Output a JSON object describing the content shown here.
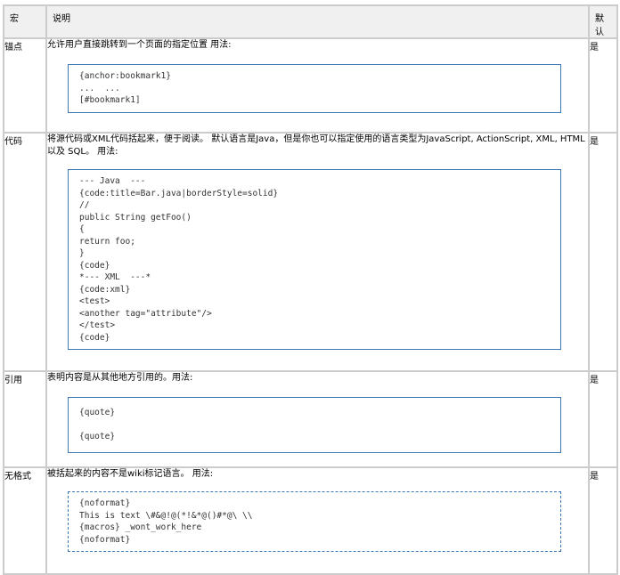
{
  "headers": {
    "macro": "宏",
    "description": "说明",
    "default": "默认"
  },
  "rows": [
    {
      "macro": "锚点",
      "description": "允许用户直接跳转到一个页面的指定位置 用法:",
      "code": [
        "{anchor:bookmark1}",
        "...  ...",
        "[#bookmark1]"
      ],
      "default": "是"
    },
    {
      "macro": "代码",
      "description": "将源代码或XML代码括起来，便于阅读。 默认语言是Java，但是你也可以指定使用的语言类型为JavaScript, ActionScript, XML, HTML 以及 SQL。 用法:",
      "code": [
        "--- Java  ---",
        "{code:title=Bar.java|borderStyle=solid}",
        "//",
        "public String getFoo()",
        "{",
        "return foo;",
        "}",
        "{code}",
        "*--- XML  ---*",
        "{code:xml}",
        "<test>",
        "<another tag=\"attribute\"/>",
        "</test>",
        "{code}"
      ],
      "default": "是"
    },
    {
      "macro": "引用",
      "description": "表明内容是从其他地方引用的。用法:",
      "code": [
        "{quote}",
        "",
        "{quote}"
      ],
      "default": "是"
    },
    {
      "macro": "无格式",
      "description": "被括起来的内容不是wiki标记语言。 用法:",
      "code": [
        "{noformat}",
        "This is text \\#&@!@(*!&*@()#*@\\ \\\\",
        "{macros} _wont_work_here",
        "{noformat}"
      ],
      "default": "是"
    }
  ]
}
